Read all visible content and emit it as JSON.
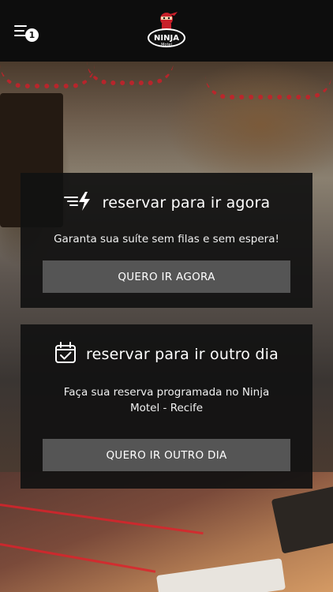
{
  "header": {
    "menu_badge_count": "1",
    "logo_icon": "ninja-logo-icon",
    "logo_text": "NINJA",
    "logo_subtext": "Motel"
  },
  "cards": [
    {
      "icon": "lightning-speed-icon",
      "title": "reservar para ir agora",
      "description": "Garanta sua suíte sem filas e sem espera!",
      "button_label": "QUERO IR AGORA"
    },
    {
      "icon": "calendar-check-icon",
      "title": "reservar para ir outro dia",
      "description": "Faça sua reserva programada no Ninja Motel - Recife",
      "button_label": "QUERO IR OUTRO DIA"
    }
  ],
  "colors": {
    "header_bg": "#0d0d0d",
    "card_bg": "#111111",
    "button_bg": "#555555",
    "accent_red": "#c8202a"
  }
}
